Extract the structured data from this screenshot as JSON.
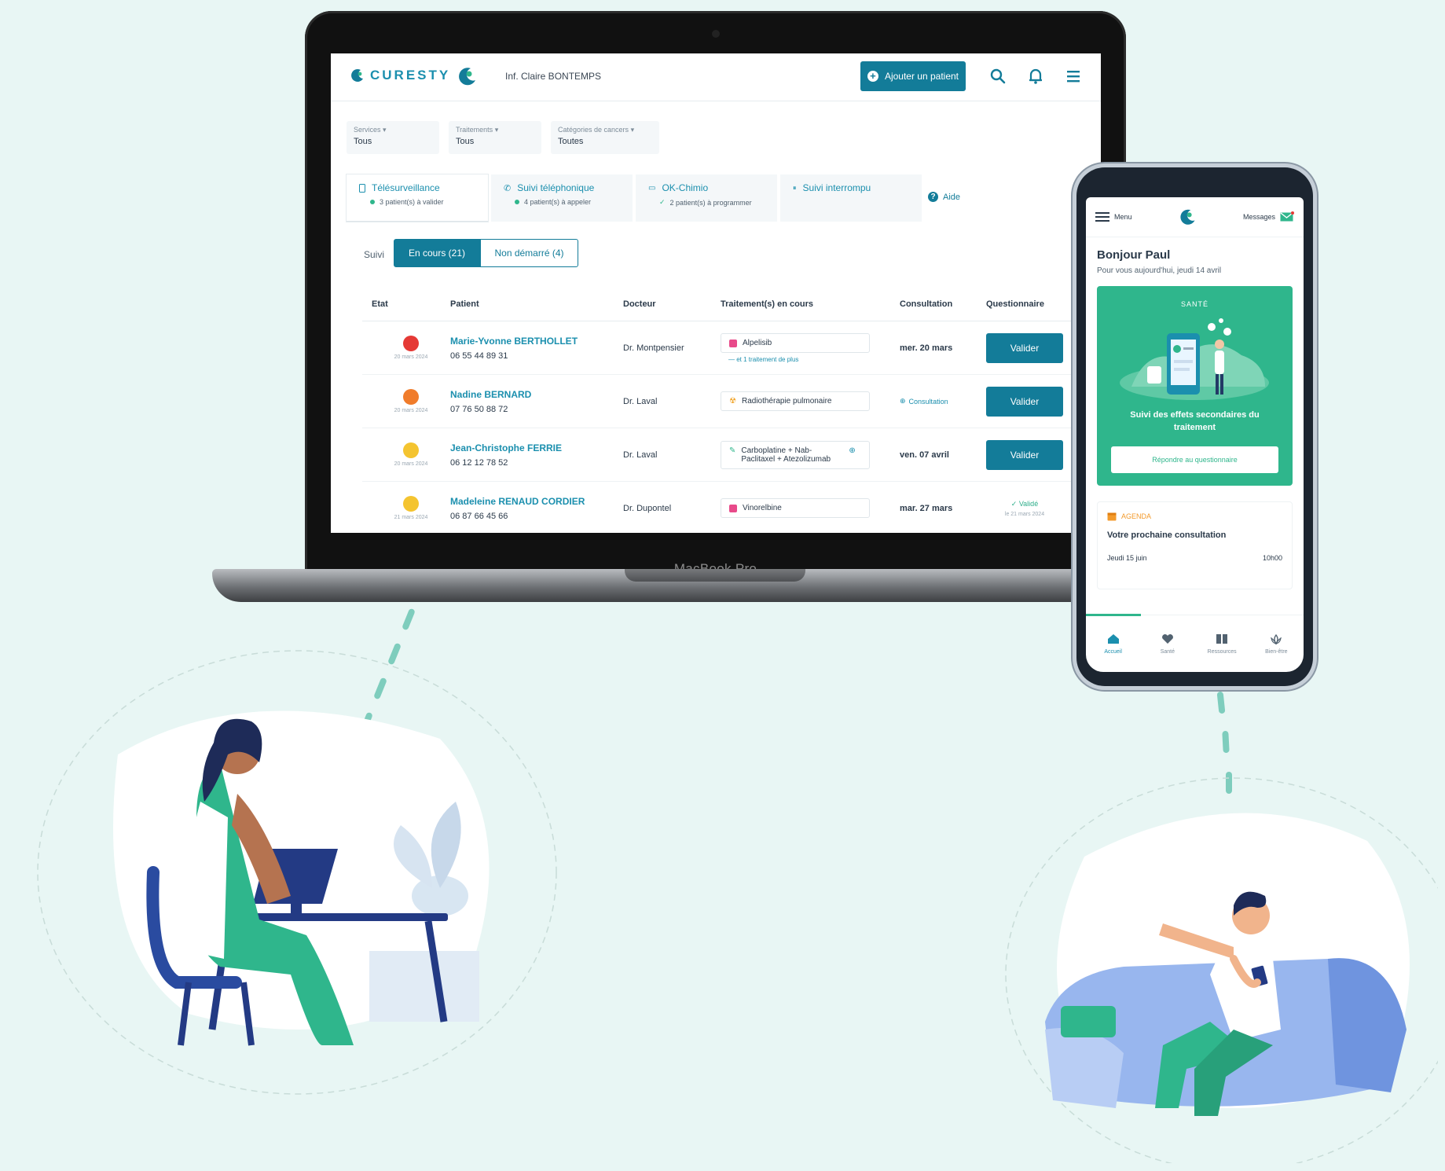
{
  "desktop_app": {
    "brand": "CURESTY",
    "user": "Inf. Claire BONTEMPS",
    "add_patient_label": "Ajouter un patient",
    "filters": [
      {
        "label": "Services",
        "value": "Tous"
      },
      {
        "label": "Traitements",
        "value": "Tous"
      },
      {
        "label": "Catégories de cancers",
        "value": "Toutes"
      }
    ],
    "tabs": [
      {
        "title": "Télésurveillance",
        "sub": "3 patient(s) à valider",
        "sub_color": "#2fb68c"
      },
      {
        "title": "Suivi téléphonique",
        "sub": "4 patient(s) à appeler",
        "sub_color": "#2fb68c"
      },
      {
        "title": "OK-Chimio",
        "sub": "2 patient(s) à programmer",
        "sub_color": "#2fb68c"
      },
      {
        "title": "Suivi interrompu",
        "sub": ""
      }
    ],
    "help_label": "Aide",
    "suivi_label": "Suivi",
    "segment_on": "En cours (21)",
    "segment_off": "Non démarré (4)",
    "columns": [
      "Etat",
      "Patient",
      "Docteur",
      "Traitement(s) en cours",
      "Consultation",
      "Questionnaire"
    ],
    "rows": [
      {
        "status_color": "#e53935",
        "date": "20 mars 2024",
        "name": "Marie-Yvonne BERTHOLLET",
        "phone": "06 55 44 89 31",
        "doctor": "Dr. Montpensier",
        "treatment": "Alpelisib",
        "treatment_icon_color": "#e84a8a",
        "more": "et 1 traitement de plus",
        "consultation": "mer. 20 mars",
        "action": "Valider"
      },
      {
        "status_color": "#f07c2b",
        "date": "20 mars 2024",
        "name": "Nadine BERNARD",
        "phone": "07 76 50 88 72",
        "doctor": "Dr. Laval",
        "treatment": "Radiothérapie pulmonaire",
        "treatment_icon_color": "#f0a020",
        "consultation_link": "Consultation",
        "action": "Valider"
      },
      {
        "status_color": "#f4c430",
        "date": "20 mars 2024",
        "name": "Jean-Christophe FERRIE",
        "phone": "06 12 12 78 52",
        "doctor": "Dr. Laval",
        "treatment": "Carboplatine + Nab-Paclitaxel + Atezolizumab",
        "treatment_icon_color": "#2fb68c",
        "consultation": "ven. 07 avril",
        "action": "Valider"
      },
      {
        "status_color": "#f4c430",
        "date": "21 mars 2024",
        "name": "Madeleine RENAUD CORDIER",
        "phone": "06 87 66 45 66",
        "doctor": "Dr. Dupontel",
        "treatment": "Vinorelbine",
        "treatment_icon_color": "#e84a8a",
        "consultation": "mar. 27 mars",
        "validated": "Validé",
        "validated_date": "le 21 mars 2024"
      }
    ],
    "device_label": "MacBook Pro"
  },
  "mobile_app": {
    "menu_label": "Menu",
    "messages_label": "Messages",
    "greeting": "Bonjour Paul",
    "subgreeting": "Pour vous aujourd'hui, jeudi 14 avril",
    "card_title": "SANTÉ",
    "card_text": "Suivi des effets secondaires du traitement",
    "card_button": "Répondre au questionnaire",
    "agenda_tag": "AGENDA",
    "agenda_title": "Votre prochaine consultation",
    "agenda_day": "Jeudi 15 juin",
    "agenda_time": "10h00",
    "nav": [
      "Accueil",
      "Santé",
      "Ressources",
      "Bien-être"
    ]
  },
  "colors": {
    "primary": "#137c99",
    "accent": "#2fb68c",
    "background": "#e8f6f4"
  }
}
